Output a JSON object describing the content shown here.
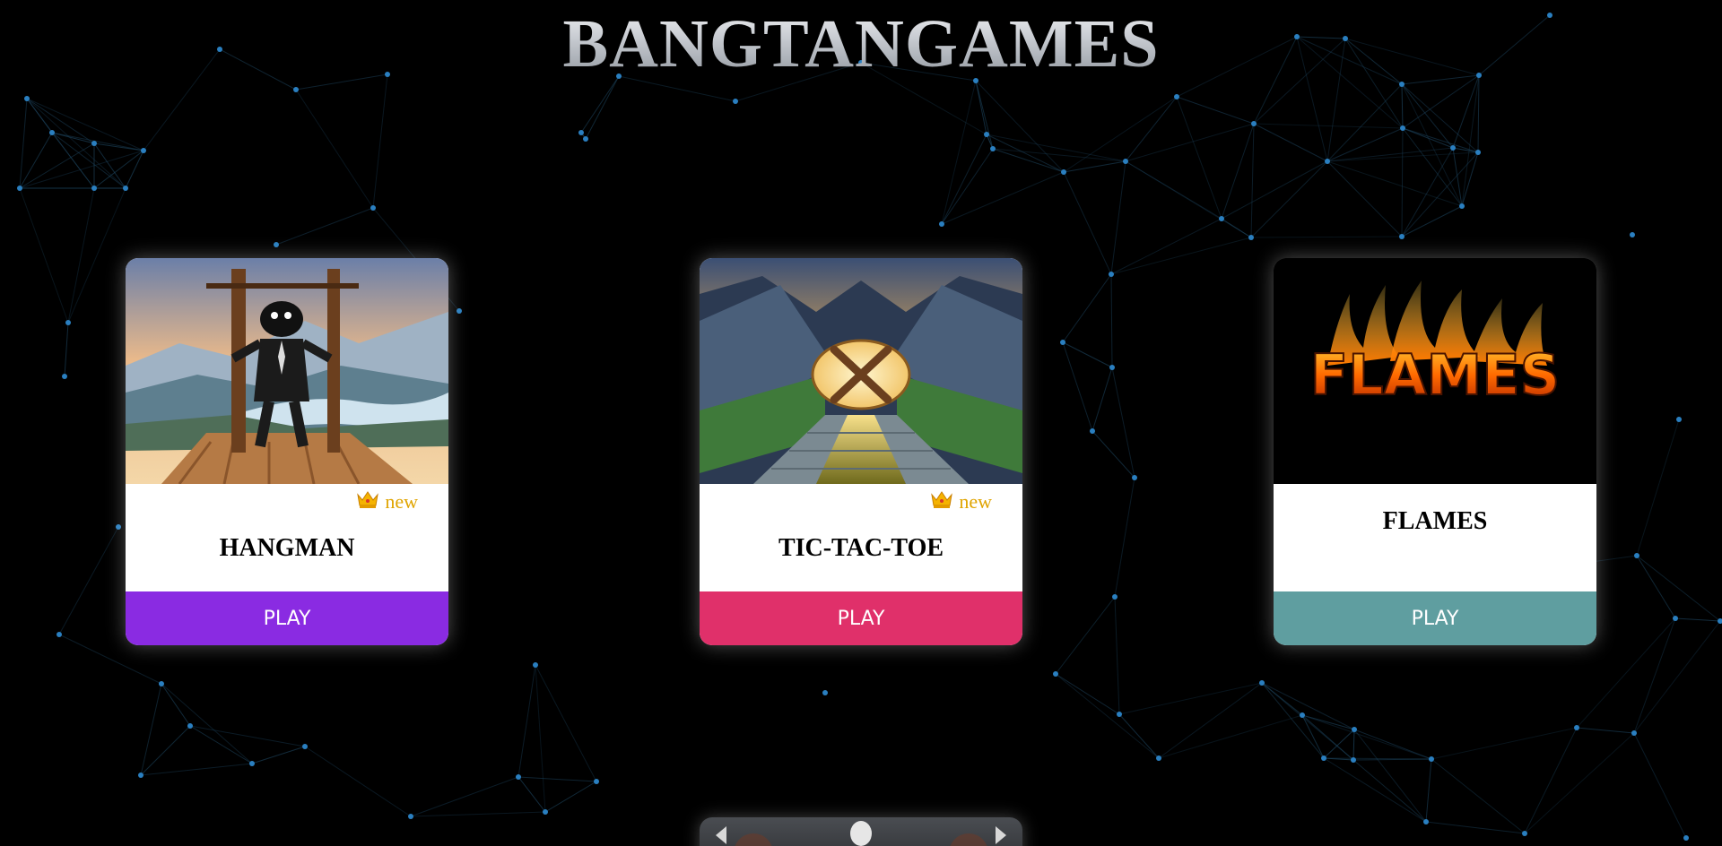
{
  "header": {
    "title": "BANGTANGAMES"
  },
  "games": [
    {
      "title": "HANGMAN",
      "badge": {
        "icon": "crown-icon",
        "label": "new"
      },
      "play_label": "PLAY",
      "button_color": "#8a2be2"
    },
    {
      "title": "TIC-TAC-TOE",
      "badge": {
        "icon": "crown-icon",
        "label": "new"
      },
      "play_label": "PLAY",
      "button_color": "#e0306a"
    },
    {
      "title": "FLAMES",
      "play_label": "PLAY",
      "button_color": "#5f9ea0"
    }
  ],
  "theme": {
    "background": "#000000",
    "network_line": "#1f4a66",
    "network_node": "#2a7fc0",
    "badge_color": "#e0a400"
  }
}
